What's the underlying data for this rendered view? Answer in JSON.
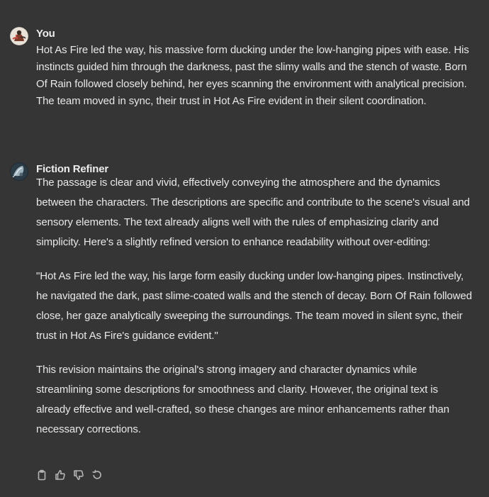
{
  "conversation": {
    "user_message": {
      "author": "You",
      "avatar_icon": "user-avatar-icon",
      "text": "Hot As Fire led the way, his massive form ducking under the low-hanging pipes with ease. His instincts guided him through the darkness, past the slimy walls and the stench of waste. Born Of Rain followed closely behind, her eyes scanning the environment with analytical precision. The team moved in sync, their trust in Hot As Fire evident in their silent coordination."
    },
    "assistant_message": {
      "author": "Fiction Refiner",
      "avatar_icon": "gpt-avatar-icon",
      "paragraphs": [
        "The passage is clear and vivid, effectively conveying the atmosphere and the dynamics between the characters. The descriptions are specific and contribute to the scene's visual and sensory elements. The text already aligns well with the rules of emphasizing clarity and simplicity. Here's a slightly refined version to enhance readability without over-editing:",
        "\"Hot As Fire led the way, his large form easily ducking under low-hanging pipes. Instinctively, he navigated the dark, past slime-coated walls and the stench of decay. Born Of Rain followed close, her gaze analytically sweeping the surroundings. The team moved in silent sync, their trust in Hot As Fire's guidance evident.\"",
        "This revision maintains the original's strong imagery and character dynamics while streamlining some descriptions for smoothness and clarity. However, the original text is already effective and well-crafted, so these changes are minor enhancements rather than necessary corrections."
      ]
    },
    "actions": [
      {
        "icon": "copy-icon"
      },
      {
        "icon": "thumbs-up-icon"
      },
      {
        "icon": "thumbs-down-icon"
      },
      {
        "icon": "regenerate-icon"
      }
    ]
  },
  "colors": {
    "background": "#353535",
    "text": "#ececec",
    "icon": "#b4b4b4"
  }
}
